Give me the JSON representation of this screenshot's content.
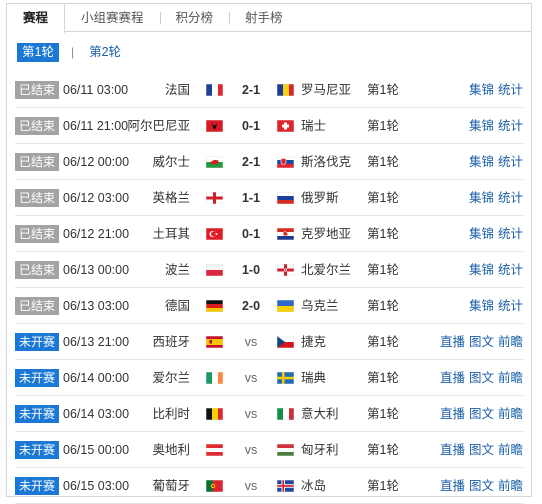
{
  "tabs": [
    {
      "label": "赛程",
      "active": true
    },
    {
      "label": "小组赛赛程",
      "active": false
    },
    {
      "label": "积分榜",
      "active": false
    },
    {
      "label": "射手榜",
      "active": false
    }
  ],
  "rounds": {
    "active": "第1轮",
    "separator": "|",
    "other": "第2轮"
  },
  "colors": {
    "accent": "#1b78d5",
    "ended_badge": "#a3a3a3",
    "link": "#1b5fa8"
  },
  "matches": [
    {
      "status": "已结束",
      "status_type": "ended",
      "time": "06/11 03:00",
      "home": "法国",
      "home_flag": "france-flag",
      "score": "2-1",
      "away": "罗马尼亚",
      "away_flag": "romania-flag",
      "round": "第1轮",
      "links": [
        "集锦",
        "统计"
      ]
    },
    {
      "status": "已结束",
      "status_type": "ended",
      "time": "06/11 21:00",
      "home": "阿尔巴尼亚",
      "home_flag": "albania-flag",
      "score": "0-1",
      "away": "瑞士",
      "away_flag": "switzerland-flag",
      "round": "第1轮",
      "links": [
        "集锦",
        "统计"
      ]
    },
    {
      "status": "已结束",
      "status_type": "ended",
      "time": "06/12 00:00",
      "home": "威尔士",
      "home_flag": "wales-flag",
      "score": "2-1",
      "away": "斯洛伐克",
      "away_flag": "slovakia-flag",
      "round": "第1轮",
      "links": [
        "集锦",
        "统计"
      ]
    },
    {
      "status": "已结束",
      "status_type": "ended",
      "time": "06/12 03:00",
      "home": "英格兰",
      "home_flag": "england-flag",
      "score": "1-1",
      "away": "俄罗斯",
      "away_flag": "russia-flag",
      "round": "第1轮",
      "links": [
        "集锦",
        "统计"
      ]
    },
    {
      "status": "已结束",
      "status_type": "ended",
      "time": "06/12 21:00",
      "home": "土耳其",
      "home_flag": "turkey-flag",
      "score": "0-1",
      "away": "克罗地亚",
      "away_flag": "croatia-flag",
      "round": "第1轮",
      "links": [
        "集锦",
        "统计"
      ]
    },
    {
      "status": "已结束",
      "status_type": "ended",
      "time": "06/13 00:00",
      "home": "波兰",
      "home_flag": "poland-flag",
      "score": "1-0",
      "away": "北爱尔兰",
      "away_flag": "northern-ireland-flag",
      "round": "第1轮",
      "links": [
        "集锦",
        "统计"
      ]
    },
    {
      "status": "已结束",
      "status_type": "ended",
      "time": "06/13 03:00",
      "home": "德国",
      "home_flag": "germany-flag",
      "score": "2-0",
      "away": "乌克兰",
      "away_flag": "ukraine-flag",
      "round": "第1轮",
      "links": [
        "集锦",
        "统计"
      ]
    },
    {
      "status": "未开赛",
      "status_type": "upcoming",
      "time": "06/13 21:00",
      "home": "西班牙",
      "home_flag": "spain-flag",
      "score": "vs",
      "away": "捷克",
      "away_flag": "czech-flag",
      "round": "第1轮",
      "links": [
        "直播",
        "图文",
        "前瞻"
      ]
    },
    {
      "status": "未开赛",
      "status_type": "upcoming",
      "time": "06/14 00:00",
      "home": "爱尔兰",
      "home_flag": "ireland-flag",
      "score": "vs",
      "away": "瑞典",
      "away_flag": "sweden-flag",
      "round": "第1轮",
      "links": [
        "直播",
        "图文",
        "前瞻"
      ]
    },
    {
      "status": "未开赛",
      "status_type": "upcoming",
      "time": "06/14 03:00",
      "home": "比利时",
      "home_flag": "belgium-flag",
      "score": "vs",
      "away": "意大利",
      "away_flag": "italy-flag",
      "round": "第1轮",
      "links": [
        "直播",
        "图文",
        "前瞻"
      ]
    },
    {
      "status": "未开赛",
      "status_type": "upcoming",
      "time": "06/15 00:00",
      "home": "奥地利",
      "home_flag": "austria-flag",
      "score": "vs",
      "away": "匈牙利",
      "away_flag": "hungary-flag",
      "round": "第1轮",
      "links": [
        "直播",
        "图文",
        "前瞻"
      ]
    },
    {
      "status": "未开赛",
      "status_type": "upcoming",
      "time": "06/15 03:00",
      "home": "葡萄牙",
      "home_flag": "portugal-flag",
      "score": "vs",
      "away": "冰岛",
      "away_flag": "iceland-flag",
      "round": "第1轮",
      "links": [
        "直播",
        "图文",
        "前瞻"
      ]
    }
  ]
}
